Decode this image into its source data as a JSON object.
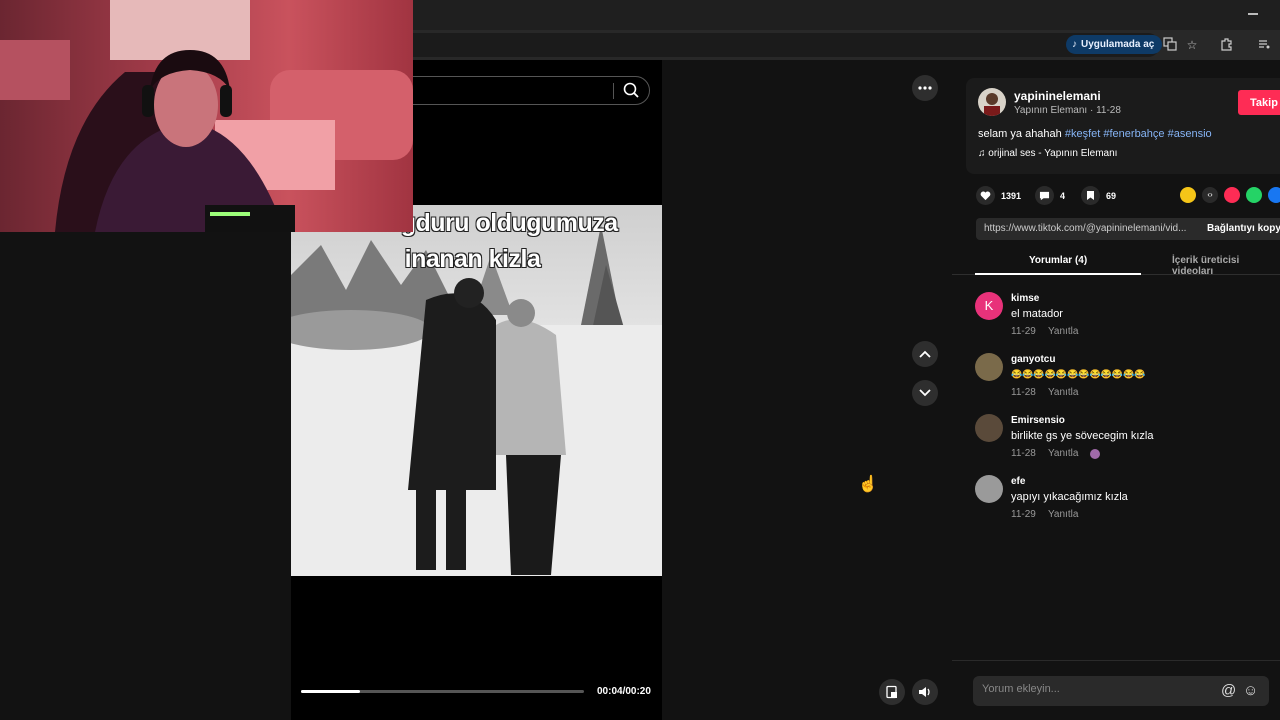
{
  "browser": {
    "open_in_app": "Uygulamada aç",
    "icons": [
      "tiktok-icon",
      "translate-icon",
      "star-icon",
      "extensions-icon",
      "media-icon",
      "minimize-icon"
    ]
  },
  "video": {
    "caption_line1": "agduru oldugumuza",
    "caption_line2": "inanan kizla",
    "time": "00:04/00:20",
    "progress": 0.21
  },
  "author": {
    "username": "yapininelemani",
    "subtitle": "Yapının Elemanı · 11-28",
    "follow_label": "Takip"
  },
  "description": {
    "text": "selam ya ahahah",
    "tags": [
      "#keşfet",
      "#fenerbahçe",
      "#asensio"
    ],
    "music": "orijinal ses - Yapının Elemanı"
  },
  "stats": {
    "likes": "1391",
    "comments": "4",
    "saves": "69"
  },
  "link": {
    "url": "https://www.tiktok.com/@yapininelemani/vid...",
    "copy_label": "Bağlantıyı kopy"
  },
  "tabs": {
    "comments": "Yorumlar (4)",
    "creator": "İçerik üreticisi videoları"
  },
  "comments": [
    {
      "user": "kimse",
      "text": "el matador",
      "date": "11-29",
      "reply": "Yanıtla",
      "avatar_letter": "K"
    },
    {
      "user": "ganyotcu",
      "text": "😂😂😂😂😂😂😂😂😂😂😂😂",
      "date": "11-28",
      "reply": "Yanıtla"
    },
    {
      "user": "Emirsensio",
      "text": "birlikte gs ye sövecegim kızla",
      "date": "11-28",
      "reply": "Yanıtla"
    },
    {
      "user": "efe",
      "text": "yapıyı yıkacağımız kızla",
      "date": "11-29",
      "reply": "Yanıtla"
    }
  ],
  "comment_input": {
    "placeholder": "Yorum ekleyin..."
  },
  "colors": {
    "accent": "#fe2c55",
    "tag": "#86b4f5",
    "background": "#121212"
  }
}
